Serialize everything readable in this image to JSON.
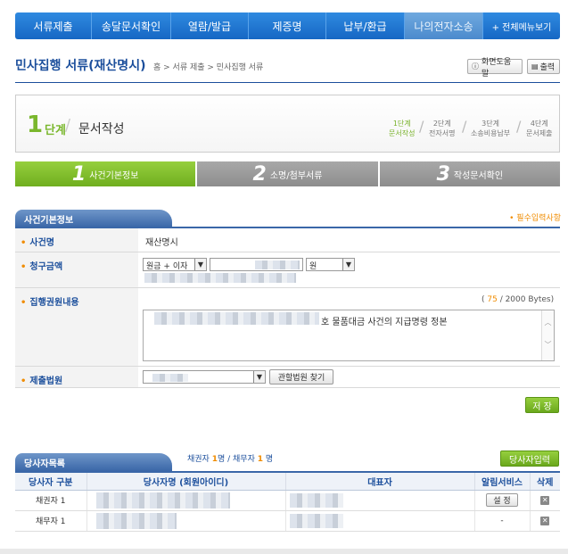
{
  "nav": {
    "items": [
      "서류제출",
      "송달문서확인",
      "열람/발급",
      "제증명",
      "납부/환급",
      "나의전자소송"
    ],
    "menu_all": "+ 전체메뉴보기"
  },
  "header": {
    "title": "민사집행 서류(재산명시)",
    "breadcrumb": "홈 > 서류 제출 > 민사집행 서류",
    "help": "화면도움말",
    "print": "출력"
  },
  "step": {
    "num": "1",
    "dan": "단계",
    "name": "문서작성",
    "mini": [
      {
        "top": "1단계",
        "bottom": "문서작성"
      },
      {
        "top": "2단계",
        "bottom": "전자서명"
      },
      {
        "top": "3단계",
        "bottom": "소송비용납부"
      },
      {
        "top": "4단계",
        "bottom": "문서제출"
      }
    ]
  },
  "tabs": [
    {
      "num": "1",
      "label": "사건기본정보"
    },
    {
      "num": "2",
      "label": "소명/첨부서류"
    },
    {
      "num": "3",
      "label": "작성문서확인"
    }
  ],
  "section": {
    "title": "사건기본정보",
    "required_note": "• 필수입력사항"
  },
  "form": {
    "case_name_label": "사건명",
    "case_name_value": "재산명시",
    "claim_label": "청구금액",
    "claim_select": "원금 + 이자",
    "claim_unit": "원",
    "content_label": "집행권원내용",
    "bytes_prefix": "( ",
    "bytes_count": "75",
    "bytes_suffix": " / 2000 Bytes)",
    "content_text": "호 물품대금 사건의 지급명령 정본",
    "court_label": "제출법원",
    "court_find": "관할법원 찾기",
    "save": "저 장"
  },
  "parties": {
    "title": "당사자목록",
    "creditor_label": "채권자 ",
    "creditor_count": "1",
    "sep": "명 / 채무자 ",
    "debtor_count": "1",
    "unit": " 명",
    "add_button": "당사자입력",
    "headers": [
      "당사자 구분",
      "당사자명 (회원아이디)",
      "대표자",
      "알림서비스",
      "삭제"
    ],
    "rows": [
      {
        "type": "채권자 1",
        "alert": "설 정"
      },
      {
        "type": "채무자 1",
        "alert": "-"
      }
    ]
  }
}
